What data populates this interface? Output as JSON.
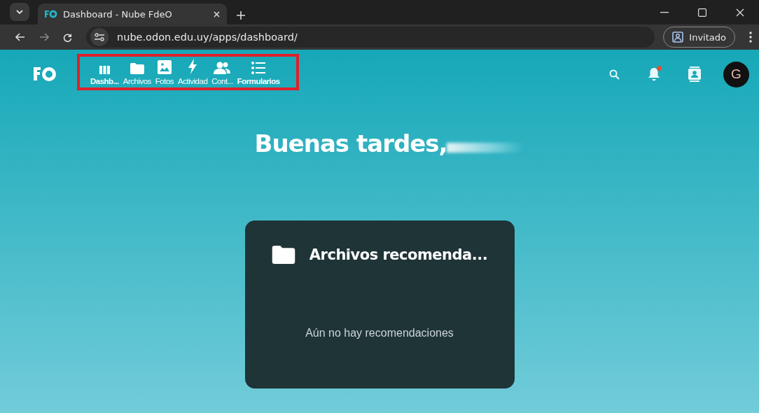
{
  "browser": {
    "tab_title": "Dashboard - Nube FdeO",
    "address": "nube.odon.edu.uy/apps/dashboard/",
    "profile_label": "Invitado"
  },
  "app_nav": {
    "highlighted": true,
    "items": [
      {
        "label": "Dashb...",
        "kind": "dashboard",
        "selected": true
      },
      {
        "label": "Archivos",
        "kind": "files",
        "selected": false
      },
      {
        "label": "Fotos",
        "kind": "photos",
        "selected": false
      },
      {
        "label": "Actividad",
        "kind": "activity",
        "selected": false
      },
      {
        "label": "Cont...",
        "kind": "contacts",
        "selected": false
      },
      {
        "label": "Formularios",
        "kind": "forms",
        "selected": true
      }
    ]
  },
  "header_right": {
    "notification_unread": true,
    "avatar_letter": "G"
  },
  "greeting": "Buenas tardes,",
  "widget": {
    "title": "Archivos recomenda...",
    "empty_text": "Aún no hay recomendaciones"
  }
}
